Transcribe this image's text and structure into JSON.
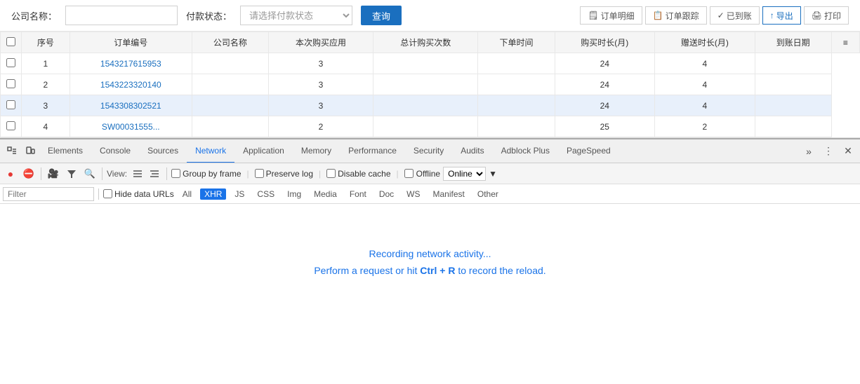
{
  "search": {
    "company_label": "公司名称：",
    "company_placeholder": "",
    "status_label": "付款状态：",
    "status_placeholder": "请选择付款状态",
    "query_btn": "查询"
  },
  "action_buttons": [
    {
      "label": "🗒 订单明细",
      "key": "detail"
    },
    {
      "label": "📋 订单跟踪",
      "key": "track"
    },
    {
      "label": "✓ 已到账",
      "key": "received"
    },
    {
      "label": "↑ 导出",
      "key": "export",
      "highlight": true
    },
    {
      "label": "🖨 打印",
      "key": "print"
    }
  ],
  "table": {
    "headers": [
      "",
      "序号",
      "订单编号",
      "公司名称",
      "本次购买应用",
      "总计购买次数",
      "下单时间",
      "购买时长(月)",
      "赠送时长(月)",
      "到账日期",
      "≡"
    ],
    "rows": [
      {
        "id": 1,
        "order": "1543217615953",
        "company": "",
        "app": "3",
        "total": "",
        "order_time": "",
        "duration": "24",
        "gift": "4",
        "arrive": "",
        "highlight": false
      },
      {
        "id": 2,
        "order": "1543223320140",
        "company": "",
        "app": "3",
        "total": "",
        "order_time": "",
        "duration": "24",
        "gift": "4",
        "arrive": "",
        "highlight": false
      },
      {
        "id": 3,
        "order": "1543308302521",
        "company": "",
        "app": "3",
        "total": "",
        "order_time": "",
        "duration": "24",
        "gift": "4",
        "arrive": "",
        "highlight": true
      },
      {
        "id": 4,
        "order": "SW00031555...",
        "company": "",
        "app": "2",
        "total": "",
        "order_time": "",
        "duration": "25",
        "gift": "2",
        "arrive": "",
        "highlight": false
      }
    ]
  },
  "devtools": {
    "tabs": [
      {
        "label": "Elements",
        "active": false
      },
      {
        "label": "Console",
        "active": false
      },
      {
        "label": "Sources",
        "active": false
      },
      {
        "label": "Network",
        "active": true
      },
      {
        "label": "Application",
        "active": false
      },
      {
        "label": "Memory",
        "active": false
      },
      {
        "label": "Performance",
        "active": false
      },
      {
        "label": "Security",
        "active": false
      },
      {
        "label": "Audits",
        "active": false
      },
      {
        "label": "Adblock Plus",
        "active": false
      },
      {
        "label": "PageSpeed",
        "active": false
      }
    ],
    "toolbar": {
      "view_label": "View:",
      "group_by_frame": "Group by frame",
      "preserve_log": "Preserve log",
      "disable_cache": "Disable cache",
      "offline": "Offline",
      "online": "Online"
    },
    "filter": {
      "placeholder": "Filter",
      "hide_data_urls": "Hide data URLs",
      "all_btn": "All",
      "types": [
        "XHR",
        "JS",
        "CSS",
        "Img",
        "Media",
        "Font",
        "Doc",
        "WS",
        "Manifest",
        "Other"
      ]
    },
    "empty": {
      "recording": "Recording network activity...",
      "hint_prefix": "Perform a request or hit ",
      "shortcut": "Ctrl + R",
      "hint_suffix": " to record the reload."
    }
  }
}
